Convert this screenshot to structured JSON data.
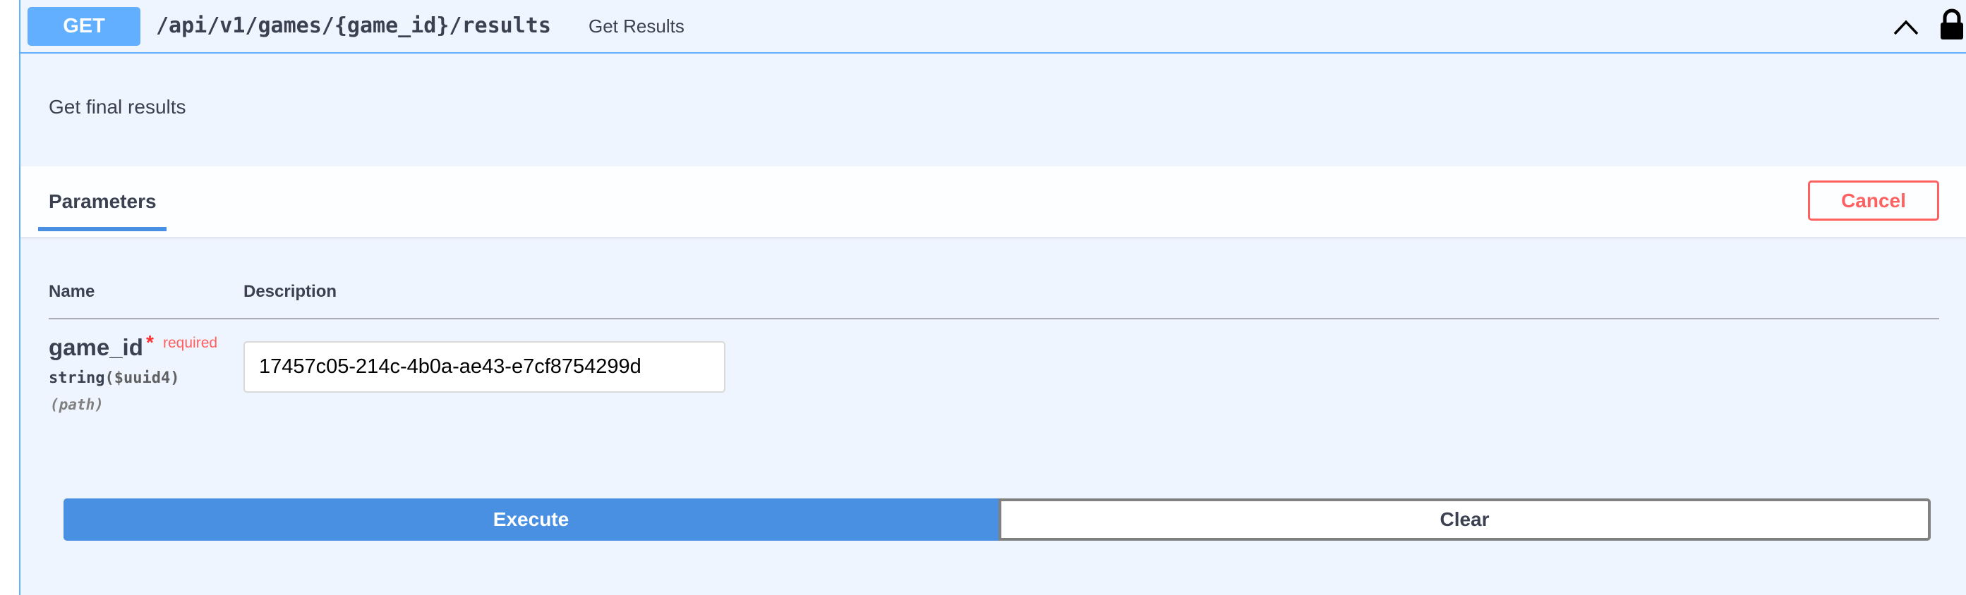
{
  "summary": {
    "method": "GET",
    "path": "/api/v1/games/{game_id}/results",
    "description": "Get Results",
    "collapse_icon": "chevron-up-icon",
    "lock_icon": "lock-icon"
  },
  "description": "Get final results",
  "parameters": {
    "tab_label": "Parameters",
    "cancel_label": "Cancel",
    "columns": {
      "name": "Name",
      "description": "Description"
    },
    "items": [
      {
        "name": "game_id",
        "required_star": "*",
        "required_label": "required",
        "type": "string",
        "format": "($uuid4)",
        "in": "(path)",
        "value": "17457c05-214c-4b0a-ae43-e7cf8754299d"
      }
    ]
  },
  "actions": {
    "execute_label": "Execute",
    "clear_label": "Clear"
  },
  "colors": {
    "get_method": "#61affe",
    "execute": "#4990e2",
    "cancel": "#ff6060",
    "background": "#eff5fe"
  }
}
